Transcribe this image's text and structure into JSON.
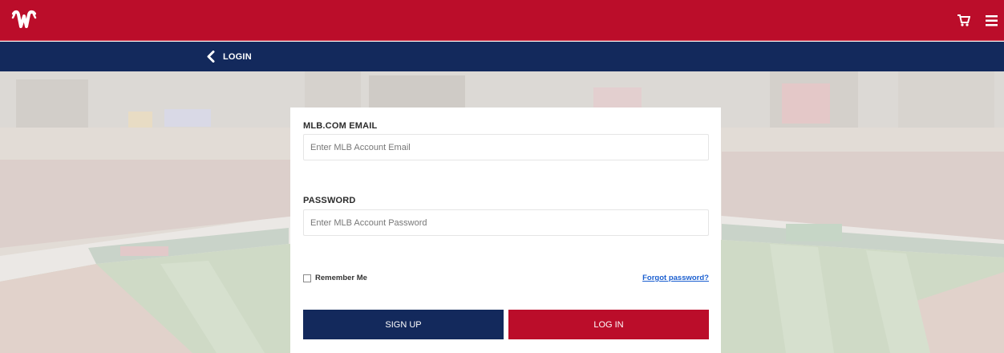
{
  "header": {
    "logo_icon": "nationals-w-logo",
    "cart_icon": "cart-icon",
    "menu_icon": "hamburger-menu-icon",
    "bg_color": "#bb0d2a"
  },
  "subheader": {
    "back_label": "LOGIN",
    "bg_color": "#13295c"
  },
  "form": {
    "email": {
      "label": "MLB.COM EMAIL",
      "placeholder": "Enter MLB Account Email",
      "value": ""
    },
    "password": {
      "label": "PASSWORD",
      "placeholder": "Enter MLB Account Password",
      "value": ""
    },
    "remember_label": "Remember Me",
    "remember_checked": false,
    "forgot_label": "Forgot password?",
    "signup_label": "SIGN UP",
    "login_label": "LOG IN"
  },
  "colors": {
    "navy": "#13295c",
    "red": "#bb0d2a",
    "link": "#1b5fd0"
  }
}
